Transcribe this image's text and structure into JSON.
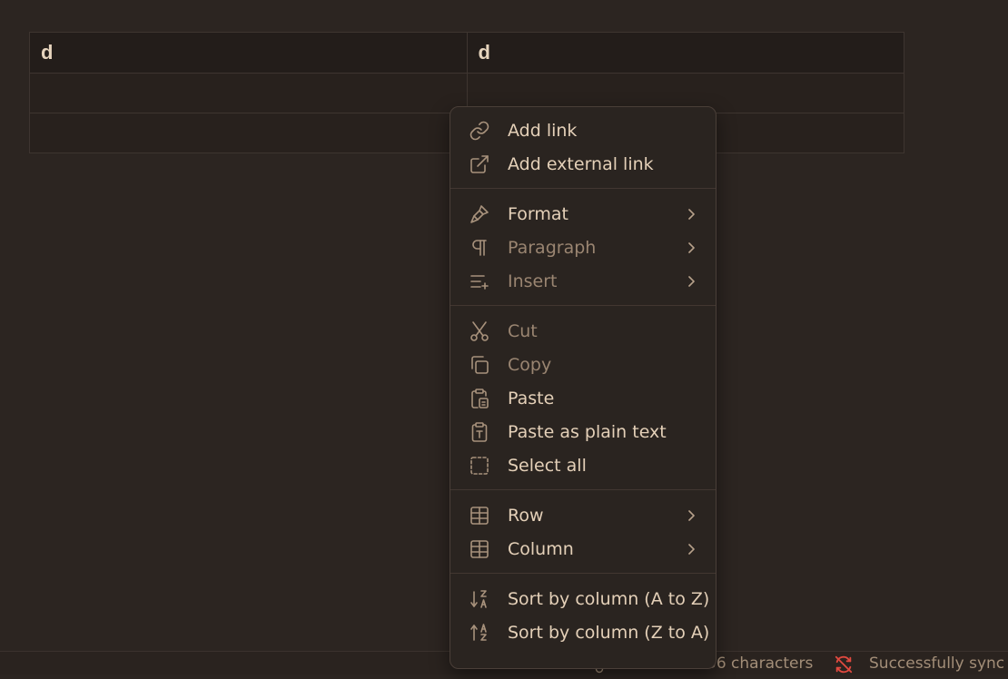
{
  "table": {
    "headers": [
      "d",
      "d"
    ],
    "rows": [
      [
        "",
        ""
      ],
      [
        "",
        ""
      ]
    ]
  },
  "status": {
    "characters": "36 characters",
    "sync": "Successfully sync"
  },
  "menu": {
    "groups": [
      [
        {
          "label": "Add link",
          "icon": "link-icon",
          "enabled": true
        },
        {
          "label": "Add external link",
          "icon": "external-link-icon",
          "enabled": true
        }
      ],
      [
        {
          "label": "Format",
          "icon": "paintbrush-icon",
          "enabled": true,
          "submenu": true
        },
        {
          "label": "Paragraph",
          "icon": "pilcrow-icon",
          "enabled": false,
          "submenu": true
        },
        {
          "label": "Insert",
          "icon": "list-plus-icon",
          "enabled": false,
          "submenu": true
        }
      ],
      [
        {
          "label": "Cut",
          "icon": "scissors-icon",
          "enabled": false
        },
        {
          "label": "Copy",
          "icon": "copy-icon",
          "enabled": false
        },
        {
          "label": "Paste",
          "icon": "clipboard-paste-icon",
          "enabled": true
        },
        {
          "label": "Paste as plain text",
          "icon": "clipboard-type-icon",
          "enabled": true
        },
        {
          "label": "Select all",
          "icon": "dashed-square-icon",
          "enabled": true
        }
      ],
      [
        {
          "label": "Row",
          "icon": "table-icon",
          "enabled": true,
          "submenu": true
        },
        {
          "label": "Column",
          "icon": "table-icon",
          "enabled": true,
          "submenu": true
        }
      ],
      [
        {
          "label": "Sort by column (A to Z)",
          "icon": "sort-ascending-icon",
          "enabled": true
        },
        {
          "label": "Sort by column (Z to A)",
          "icon": "sort-descending-icon",
          "enabled": true
        }
      ]
    ]
  },
  "colors": {
    "background": "#2c2521",
    "menu_background": "#2a2420",
    "text": "#e4d0b8",
    "muted_text": "#9a8571",
    "sync_error": "#e0493f"
  }
}
